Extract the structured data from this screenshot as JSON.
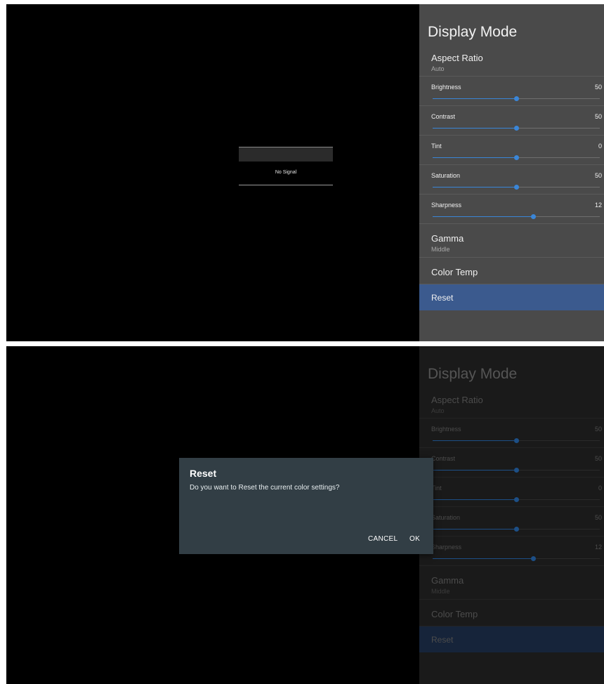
{
  "no_signal": {
    "text": "No Signal"
  },
  "panel": {
    "title": "Display Mode",
    "aspect_ratio": {
      "label": "Aspect Ratio",
      "value": "Auto"
    },
    "sliders": [
      {
        "label": "Brightness",
        "value": "50",
        "level": 0.5
      },
      {
        "label": "Contrast",
        "value": "50",
        "level": 0.5
      },
      {
        "label": "Tint",
        "value": "0",
        "level": 0.5
      },
      {
        "label": "Saturation",
        "value": "50",
        "level": 0.5
      },
      {
        "label": "Sharpness",
        "value": "12",
        "level": 0.6
      }
    ],
    "gamma": {
      "label": "Gamma",
      "value": "Middle"
    },
    "color_temp": {
      "label": "Color Temp"
    },
    "reset": {
      "label": "Reset"
    }
  },
  "dialog": {
    "title": "Reset",
    "message": "Do you want to Reset the current color settings?",
    "cancel_label": "CANCEL",
    "ok_label": "OK"
  },
  "colors": {
    "accent": "#3a86d8",
    "selected_row": "#3b5a8e",
    "panel_bg": "#4a4a4a",
    "dialog_bg": "#323e45"
  }
}
